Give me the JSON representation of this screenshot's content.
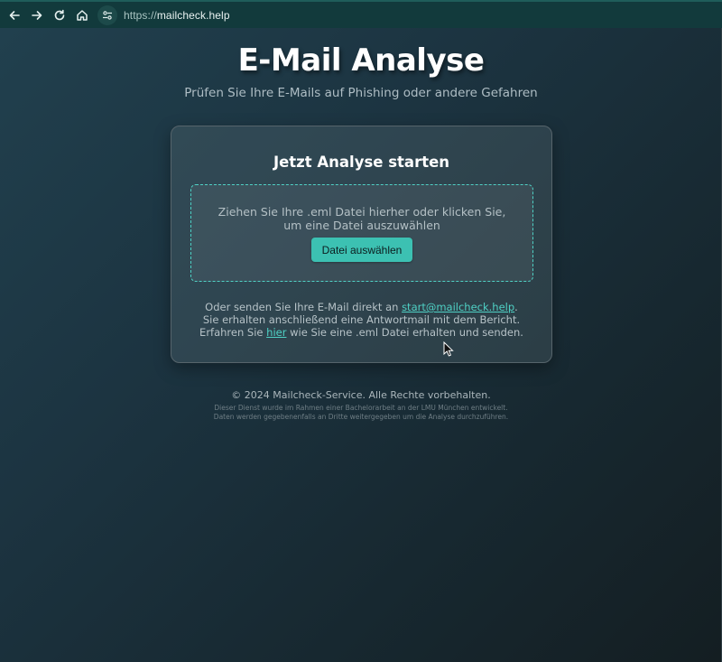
{
  "browser": {
    "url_scheme": "https://",
    "url_host": "mailcheck.help",
    "icons": [
      "back-arrow-icon",
      "forward-arrow-icon",
      "reload-icon",
      "home-icon",
      "site-settings-icon"
    ]
  },
  "header": {
    "title": "E-Mail Analyse",
    "subtitle": "Prüfen Sie Ihre E-Mails auf Phishing oder andere Gefahren"
  },
  "card": {
    "title": "Jetzt Analyse starten",
    "dropzone_text": "Ziehen Sie Ihre .eml Datei hierher oder klicken Sie, um eine Datei auszuwählen",
    "select_button_label": "Datei auswählen",
    "info_line1_prefix": "Oder senden Sie Ihre E-Mail direkt an ",
    "info_email_link": "start@mailcheck.help",
    "info_line1_suffix": ".",
    "info_line2": "Sie erhalten anschließend eine Antwortmail mit dem Bericht.",
    "info_line3_prefix": "Erfahren Sie ",
    "info_here_link": "hier",
    "info_line3_suffix": " wie Sie eine .eml Datei erhalten und senden."
  },
  "footer": {
    "copyright": "© 2024 Mailcheck-Service. Alle Rechte vorbehalten.",
    "note_line1": "Dieser Dienst wurde im Rahmen einer Bachelorarbeit an der LMU München entwickelt.",
    "note_line2": "Daten werden gegebenenfalls an Dritte weitergegeben um die Analyse durchzuführen."
  },
  "colors": {
    "accent": "#4fd1c5",
    "button": "#3cc1b2",
    "browser_bar": "#123a3c"
  }
}
